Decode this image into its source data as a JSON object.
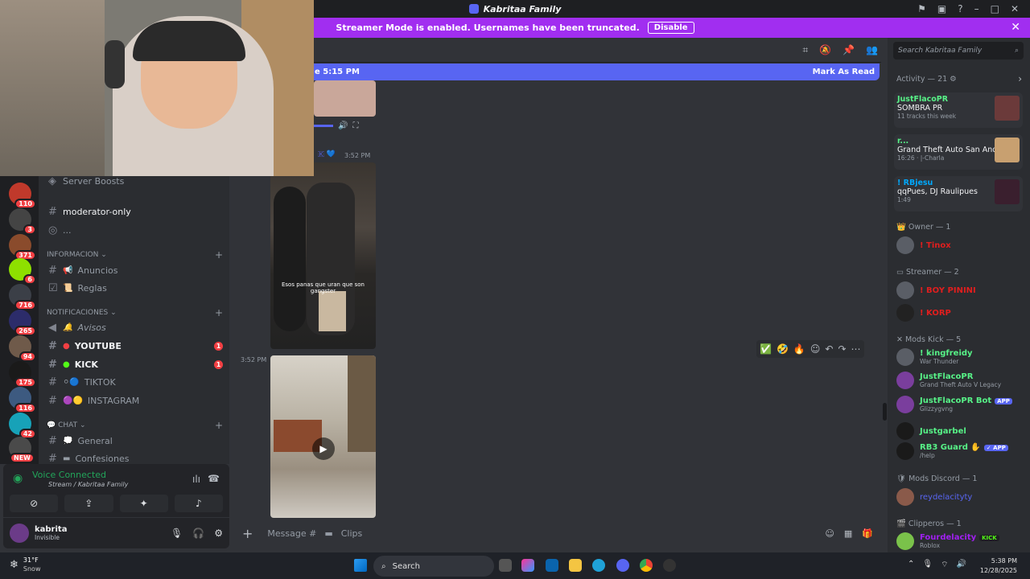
{
  "window": {
    "title": "Kabritaa Family",
    "title_icon": "discord-icon"
  },
  "streamer_banner": {
    "text": "Streamer Mode is enabled. Usernames have been truncated.",
    "button": "Disable"
  },
  "guilds": [
    {
      "badge": "110"
    },
    {
      "badge": "3"
    },
    {
      "badge": "371"
    },
    {
      "badge": "6"
    },
    {
      "badge": "716"
    },
    {
      "badge": "265"
    },
    {
      "badge": "94"
    },
    {
      "badge": "175"
    },
    {
      "badge": "116"
    },
    {
      "badge": "42"
    },
    {
      "badge": "NEW"
    }
  ],
  "channels": {
    "server_boosts": "Server Boosts",
    "moderator": "moderator-only",
    "ellipsis": "...",
    "cat_informacion": "INFORMACION",
    "anuncios": "Anuncios",
    "reglas": "Reglas",
    "cat_notificaciones": "NOTIFICACIONES",
    "avisos": "Avisos",
    "youtube": "YOUTUBE",
    "youtube_unread": "1",
    "kick": "KICK",
    "kick_unread": "1",
    "tiktok": "TIKTOK",
    "instagram": "INSTAGRAM",
    "cat_chat": "CHAT",
    "general": "General",
    "confesiones": "Confesiones"
  },
  "voice": {
    "status": "Voice Connected",
    "channel": "Stream / Kabritaa Family"
  },
  "user": {
    "name": "kabrita",
    "status": "Invisible"
  },
  "chat": {
    "new_messages": "e 5:15 PM",
    "mark_as_read": "Mark As Read",
    "msg1_time": "3:52 PM",
    "msg1_caption": "Esos panas que uran que son gangster",
    "msg2_time": "3:52 PM",
    "composer_placeholder": "Message #",
    "composer_channel": "Clips"
  },
  "members": {
    "search_placeholder": "Search Kabritaa Family",
    "activity_header": "Activity — 21",
    "activities": [
      {
        "name": "JustFlacoPR",
        "title": "SOMBRA PR",
        "sub": "11 tracks this week"
      },
      {
        "name": "r...",
        "title": "Grand Theft Auto San Andr...",
        "sub": "16:26 · |-Charla"
      },
      {
        "name": "! RBjesu",
        "title": "qqPues, DJ Raulipues",
        "sub": "1:49"
      }
    ],
    "owner_header": "Owner — 1",
    "owner_name": "! Tinox",
    "streamer_header": "Streamer — 2",
    "streamers": [
      "! BOY PININI",
      "! KORP"
    ],
    "mods_kick_header": "Mods Kick — 5",
    "mods_kick": [
      {
        "name": "! kingfreidy",
        "sub": "War Thunder",
        "color": "#57f287"
      },
      {
        "name": "JustFlacoPR",
        "sub": "Grand Theft Auto V Legacy",
        "color": "#57f287"
      },
      {
        "name": "JustFlacoPR Bot",
        "sub": "Glizzygvng",
        "color": "#57f287",
        "app": "APP"
      },
      {
        "name": "Justgarbel",
        "sub": "",
        "color": "#57f287"
      },
      {
        "name": "RB3 Guard",
        "sub": "/help",
        "color": "#57f287",
        "app": "✓ APP"
      }
    ],
    "mods_discord_header": "Mods Discord — 1",
    "mods_discord": "reydelacityty",
    "clipers_header": "Clipperos — 1",
    "cliper_name": "Fourdelacity",
    "cliper_sub": "Roblox",
    "cliper_tag": "KICK"
  },
  "taskbar": {
    "weather_temp": "31°F",
    "weather_desc": "Snow",
    "search": "Search",
    "time": "5:38 PM",
    "date": "12/28/2025"
  }
}
